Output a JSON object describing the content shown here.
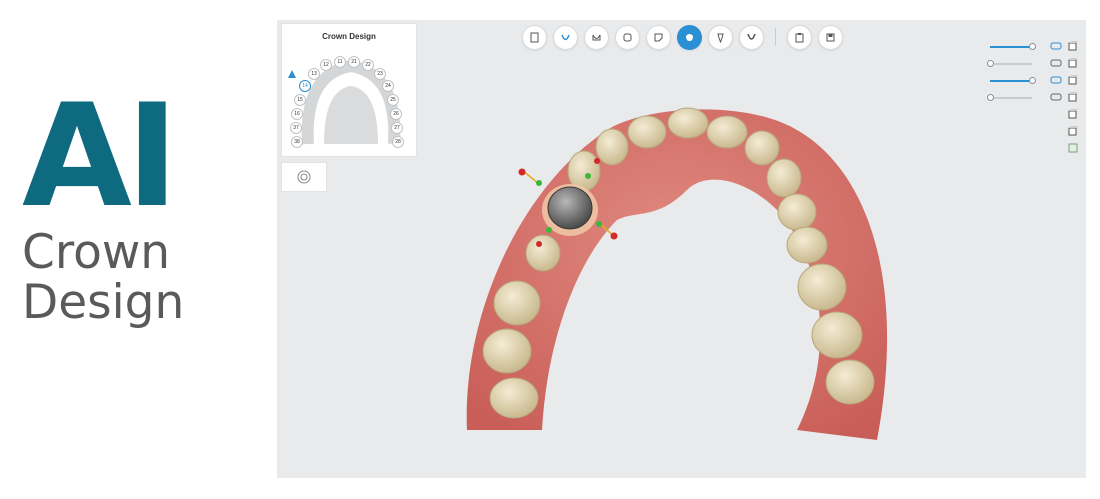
{
  "brand": {
    "line1": "AI",
    "line2": "Crown",
    "line3": "Design",
    "color": "#0e6a7e"
  },
  "panel": {
    "title": "Crown Design",
    "teeth": [
      "11",
      "12",
      "13",
      "14",
      "15",
      "16",
      "37",
      "38",
      "21",
      "22",
      "23",
      "24",
      "25",
      "26",
      "27",
      "28"
    ],
    "selected": "14"
  },
  "toolbar": {
    "buttons": [
      {
        "icon": "order-form-icon",
        "active": false
      },
      {
        "icon": "arch-icon",
        "active": false
      },
      {
        "icon": "margin-line-icon",
        "active": false
      },
      {
        "icon": "prep-tooth-icon",
        "active": false
      },
      {
        "icon": "bite-icon",
        "active": false
      },
      {
        "icon": "crown-design-icon",
        "active": true
      },
      {
        "icon": "implant-icon",
        "active": false
      },
      {
        "icon": "lower-arch-icon",
        "active": false
      },
      {
        "icon": "clipboard-icon",
        "active": false
      },
      {
        "icon": "save-icon",
        "active": false
      }
    ],
    "active_color": "#2a8fd3"
  },
  "sliders": [
    {
      "level": 1.0,
      "active": true,
      "icon": "upper-jaw-icon"
    },
    {
      "level": 0.0,
      "active": false,
      "icon": "lower-jaw-icon"
    },
    {
      "level": 1.0,
      "active": true,
      "icon": "tooth-layer-icon"
    },
    {
      "level": 0.0,
      "active": false,
      "icon": "gum-layer-icon"
    }
  ],
  "view_cubes": [
    "front-view-icon",
    "back-view-icon",
    "left-view-icon",
    "right-view-icon",
    "top-view-icon",
    "bottom-view-icon",
    "fit-view-icon"
  ]
}
